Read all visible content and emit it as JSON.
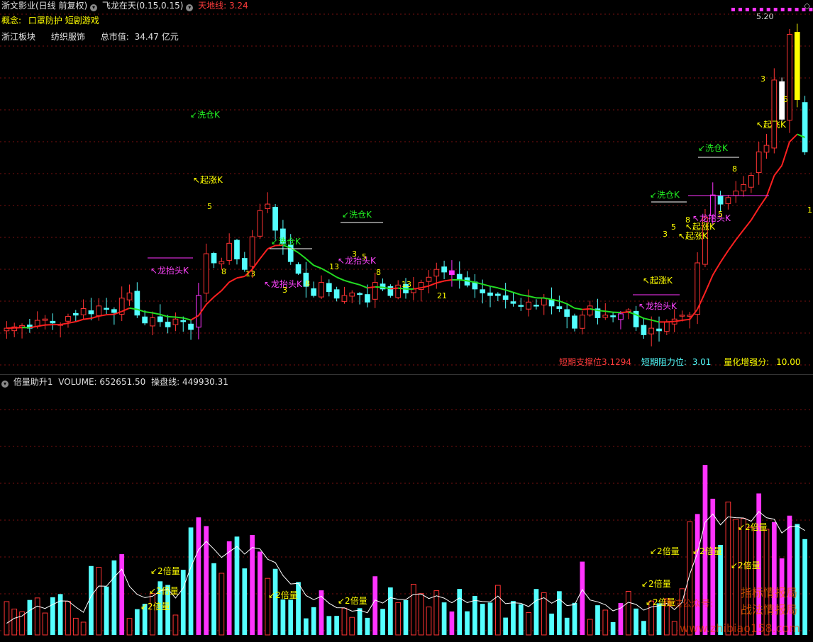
{
  "header": {
    "stock_title": "浙文影业(日线 前复权)",
    "indicator_name": "飞龙在天(0.15,0.15)",
    "indicator_value_label": "天地线: 3.24",
    "concept_label": "概念:",
    "concept_value": "口罩防护 短剧游戏",
    "sector": "浙江板块",
    "industry": "纺织服饰",
    "market_cap_label": "总市值:",
    "market_cap_value": "34.47 亿元",
    "high_label": "5.20",
    "right_marker": "◇"
  },
  "support_resistance": {
    "support_label": "短期支撑位",
    "support_value": "3.12",
    "support_value2": "94",
    "resistance_label": "短期阻力位:",
    "resistance_value": "3.01",
    "score_label": "量化增强分:",
    "score_value": "10.00",
    "edge_value": "1"
  },
  "volume_header": {
    "name": "倍量助升1",
    "volume_label": "VOLUME: 652651.50",
    "line_label": "操盘线: 449930.31"
  },
  "annotations": {
    "xicang": "洗仓K",
    "qizhang": "起涨K",
    "longtaitou": "龙抬头K",
    "qifei": "起飞K",
    "beiliang": "2倍量"
  },
  "watermark": {
    "line1": "指标情报局",
    "line2": "战法情报局",
    "gzh": "微信公众号:",
    "url": "www.zhibiao158.com"
  },
  "colors": {
    "up": "#ff3333",
    "down": "#54ffff",
    "signal": "#ff33ff",
    "ma_up": "#ff2020",
    "ma_down": "#22dd22",
    "wash": "#ffffff",
    "yellow": "#ffff00",
    "grid": "#7a1010"
  },
  "chart_data": [
    {
      "type": "candlestick",
      "title": "浙文影业(日线 前复权)",
      "series_close": [
        2.95,
        2.96,
        2.97,
        2.95,
        3.01,
        3.02,
        2.99,
        2.98,
        3.04,
        3.05,
        3.1,
        3.06,
        3.12,
        3.1,
        3.07,
        3.18,
        3.22,
        3.05,
        2.99,
        3.03,
        3.0,
        2.96,
        3.02,
        3.0,
        2.94,
        3.2,
        3.52,
        3.45,
        3.46,
        3.6,
        3.48,
        3.4,
        3.65,
        3.85,
        3.9,
        3.7,
        3.6,
        3.46,
        3.37,
        3.27,
        3.2,
        3.3,
        3.23,
        3.18,
        3.2,
        3.22,
        3.21,
        3.15,
        3.3,
        3.25,
        3.2,
        3.28,
        3.22,
        3.25,
        3.3,
        3.34,
        3.4,
        3.38,
        3.36,
        3.32,
        3.28,
        3.25,
        3.22,
        3.2,
        3.2,
        3.17,
        3.14,
        3.12,
        3.15,
        3.12,
        3.18,
        3.12,
        3.1,
        3.04,
        2.95,
        3.05,
        3.12,
        3.03,
        3.05,
        3.04,
        3.06,
        3.09,
        2.96,
        2.9,
        2.95,
        2.93,
        3.0,
        3.02,
        3.05,
        3.05,
        3.45,
        3.8,
        3.97,
        3.9,
        3.95,
        4.0,
        4.05,
        4.12,
        4.3,
        4.35,
        4.85,
        4.55,
        5.2,
        4.7,
        4.3
      ]
    },
    {
      "type": "bar",
      "title": "倍量助升1",
      "series": [
        {
          "name": "VOLUME",
          "last": 652651.5
        },
        {
          "name": "操盘线",
          "last": 449930.31
        }
      ]
    }
  ]
}
